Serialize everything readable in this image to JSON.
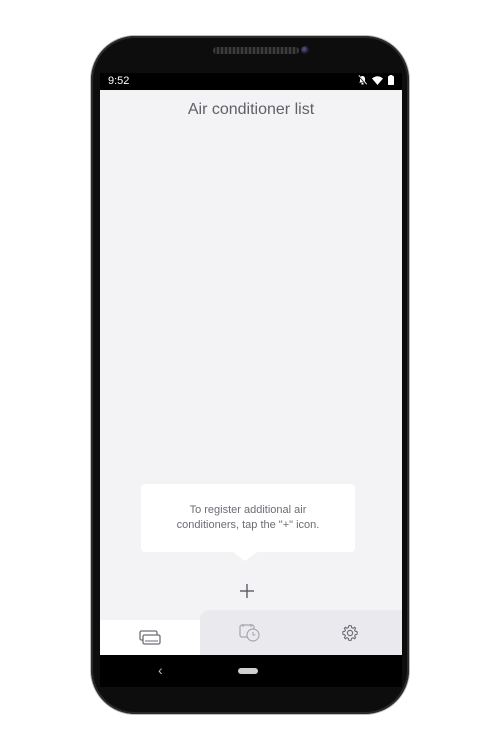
{
  "status_bar": {
    "time": "9:52",
    "icons": [
      "bell-off-icon",
      "wifi-icon",
      "battery-icon"
    ]
  },
  "app": {
    "title": "Air conditioner list"
  },
  "tooltip": {
    "text": "To register additional air conditioners, tap the \"+\" icon."
  },
  "add_button": {
    "icon": "plus-icon"
  },
  "tab_bar": {
    "tabs": [
      {
        "icon": "air-conditioner-list-icon",
        "active": true
      },
      {
        "icon": "timer-schedule-icon",
        "active": false
      },
      {
        "icon": "settings-gear-icon",
        "active": false
      }
    ]
  },
  "nav_bar": {
    "buttons": [
      "back-icon",
      "home-pill-icon"
    ]
  },
  "colors": {
    "screen_bg": "#f3f3f5",
    "title_text": "#606068",
    "tooltip_text": "#6c6c74",
    "icon_gray": "#8a8a92",
    "tab_inactive_bg": "#e9e9ee"
  }
}
